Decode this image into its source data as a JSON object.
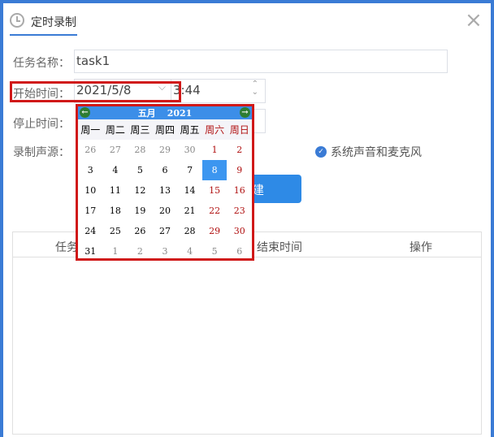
{
  "dialog": {
    "title": "定时录制",
    "close": "×"
  },
  "form": {
    "task_name_label": "任务名称：",
    "task_name_value": "task1",
    "start_label": "开始时间：",
    "start_date": "2021/5/8",
    "start_time": "3:44",
    "stop_label": "停止时间：",
    "source_label": "录制声源：",
    "source_option": "系统声音和麦克风",
    "create_button": "建"
  },
  "calendar": {
    "month": "五月",
    "year": "2021",
    "weekdays": [
      "周一",
      "周二",
      "周三",
      "周四",
      "周五",
      "周六",
      "周日"
    ],
    "days": [
      [
        "26",
        "27",
        "28",
        "29",
        "30",
        "1",
        "2"
      ],
      [
        "3",
        "4",
        "5",
        "6",
        "7",
        "8",
        "9"
      ],
      [
        "10",
        "11",
        "12",
        "13",
        "14",
        "15",
        "16"
      ],
      [
        "17",
        "18",
        "19",
        "20",
        "21",
        "22",
        "23"
      ],
      [
        "24",
        "25",
        "26",
        "27",
        "28",
        "29",
        "30"
      ],
      [
        "31",
        "1",
        "2",
        "3",
        "4",
        "5",
        "6"
      ]
    ],
    "selected": "8"
  },
  "table": {
    "headers": [
      "任务",
      "结束时间",
      "操作"
    ]
  }
}
